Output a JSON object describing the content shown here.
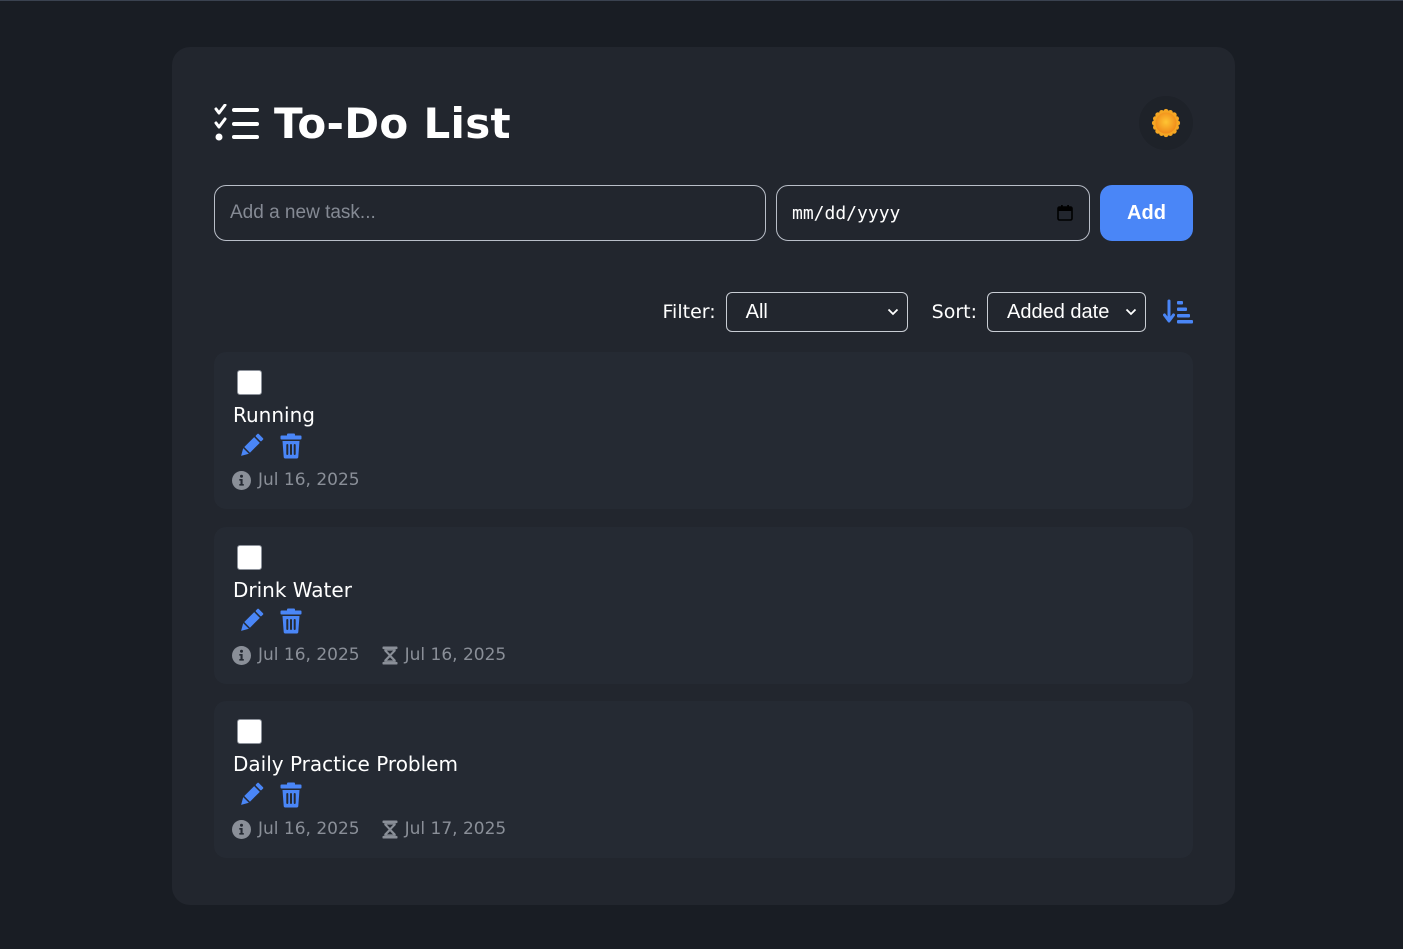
{
  "app": {
    "title": "To-Do List",
    "theme_icon": "sun-icon"
  },
  "colors": {
    "background": "#191d24",
    "card": "#22262e",
    "accent": "#4a86f7",
    "muted_text": "#8a8f98"
  },
  "new_task": {
    "placeholder": "Add a new task...",
    "value": "",
    "date_placeholder": "mm/dd/yyyy",
    "add_label": "Add"
  },
  "controls": {
    "filter_label": "Filter:",
    "filter_value": "All",
    "sort_label": "Sort:",
    "sort_value": "Added date",
    "sort_direction_icon": "sort-descending-icon"
  },
  "tasks": [
    {
      "text": "Running",
      "completed": false,
      "added": "Jul 16, 2025",
      "due": ""
    },
    {
      "text": "Drink Water",
      "completed": false,
      "added": "Jul 16, 2025",
      "due": "Jul 16, 2025"
    },
    {
      "text": "Daily Practice Problem",
      "completed": false,
      "added": "Jul 16, 2025",
      "due": "Jul 17, 2025"
    }
  ]
}
